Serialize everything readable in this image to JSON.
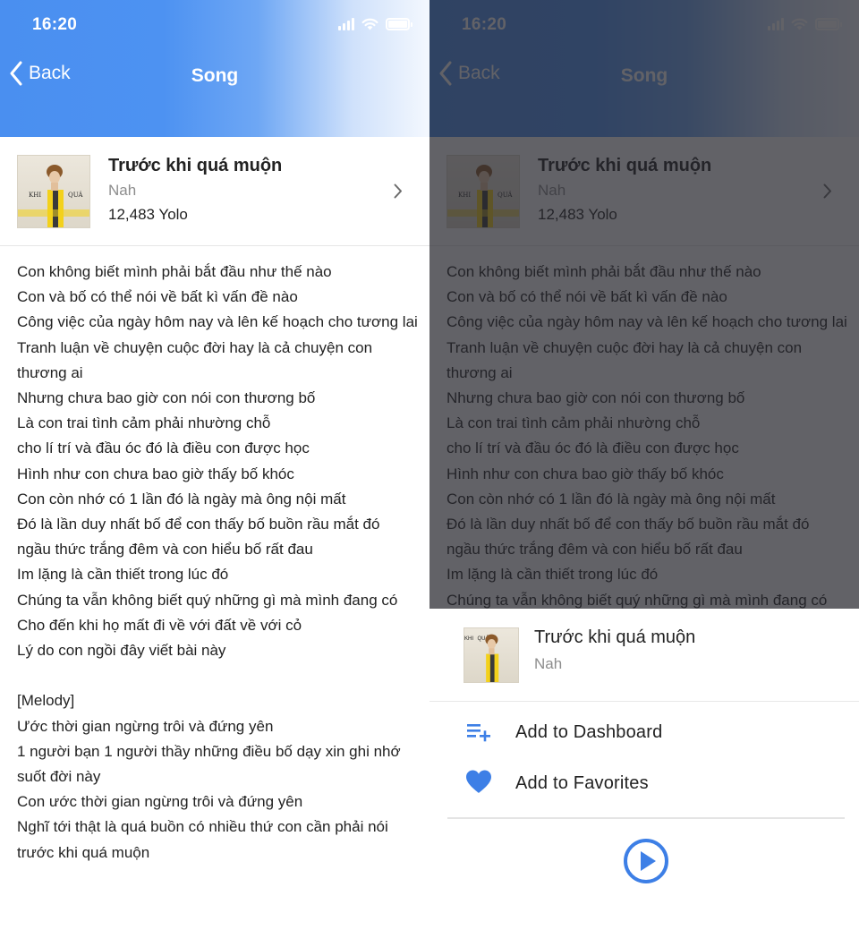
{
  "status_bar": {
    "time": "16:20"
  },
  "nav": {
    "back_label": "Back",
    "title": "Song"
  },
  "song": {
    "title": "Trước khi quá muộn",
    "artist": "Nah",
    "count": "12,483 Yolo",
    "cover_text": {
      "left": "KHI",
      "right": "QUÁ"
    }
  },
  "lyrics": "Con không biết mình phải bắt đầu như thế nào\nCon và bố có thể nói về bất kì vấn đề nào\nCông việc của ngày hôm nay và lên kế hoạch cho tương lai\nTranh luận về chuyện cuộc đời hay là cả chuyện con thương ai\nNhưng chưa bao giờ con nói con thương bố\nLà con trai tình cảm phải nhường chỗ\ncho lí trí và đầu óc đó là điều con được học\nHình như con chưa bao giờ thấy bố khóc\nCon còn nhớ có 1 lần đó là ngày mà ông nội mất\nĐó là lần duy nhất bố để con thấy bố buồn rầu mắt đó\nngầu thức trắng đêm và con hiểu bố rất đau\nIm lặng là cần thiết trong lúc đó\nChúng ta vẫn không biết quý những gì mà mình đang có\nCho đến khi họ mất đi về với đất về với cỏ\nLý do con ngồi đây viết bài này\n\n[Melody]\nƯớc thời gian ngừng trôi và đứng yên\n1 người bạn 1 người thầy những điều bố dạy xin ghi nhớ suốt đời này\nCon ước thời gian ngừng trôi và đứng yên\nNghĩ tới thật là quá buồn có nhiều thứ con cần phải nói trước khi quá muộn",
  "sheet": {
    "song_title": "Trước khi quá muộn",
    "song_artist": "Nah",
    "actions": [
      {
        "label": "Add to Dashboard",
        "icon": "playlist-add-icon"
      },
      {
        "label": "Add to Favorites",
        "icon": "heart-icon"
      }
    ],
    "play_icon": "play-circle-icon"
  },
  "colors": {
    "accent": "#4a8ff0",
    "header_gradient_end": "#f4f8fe",
    "overlay": "#26262c"
  }
}
